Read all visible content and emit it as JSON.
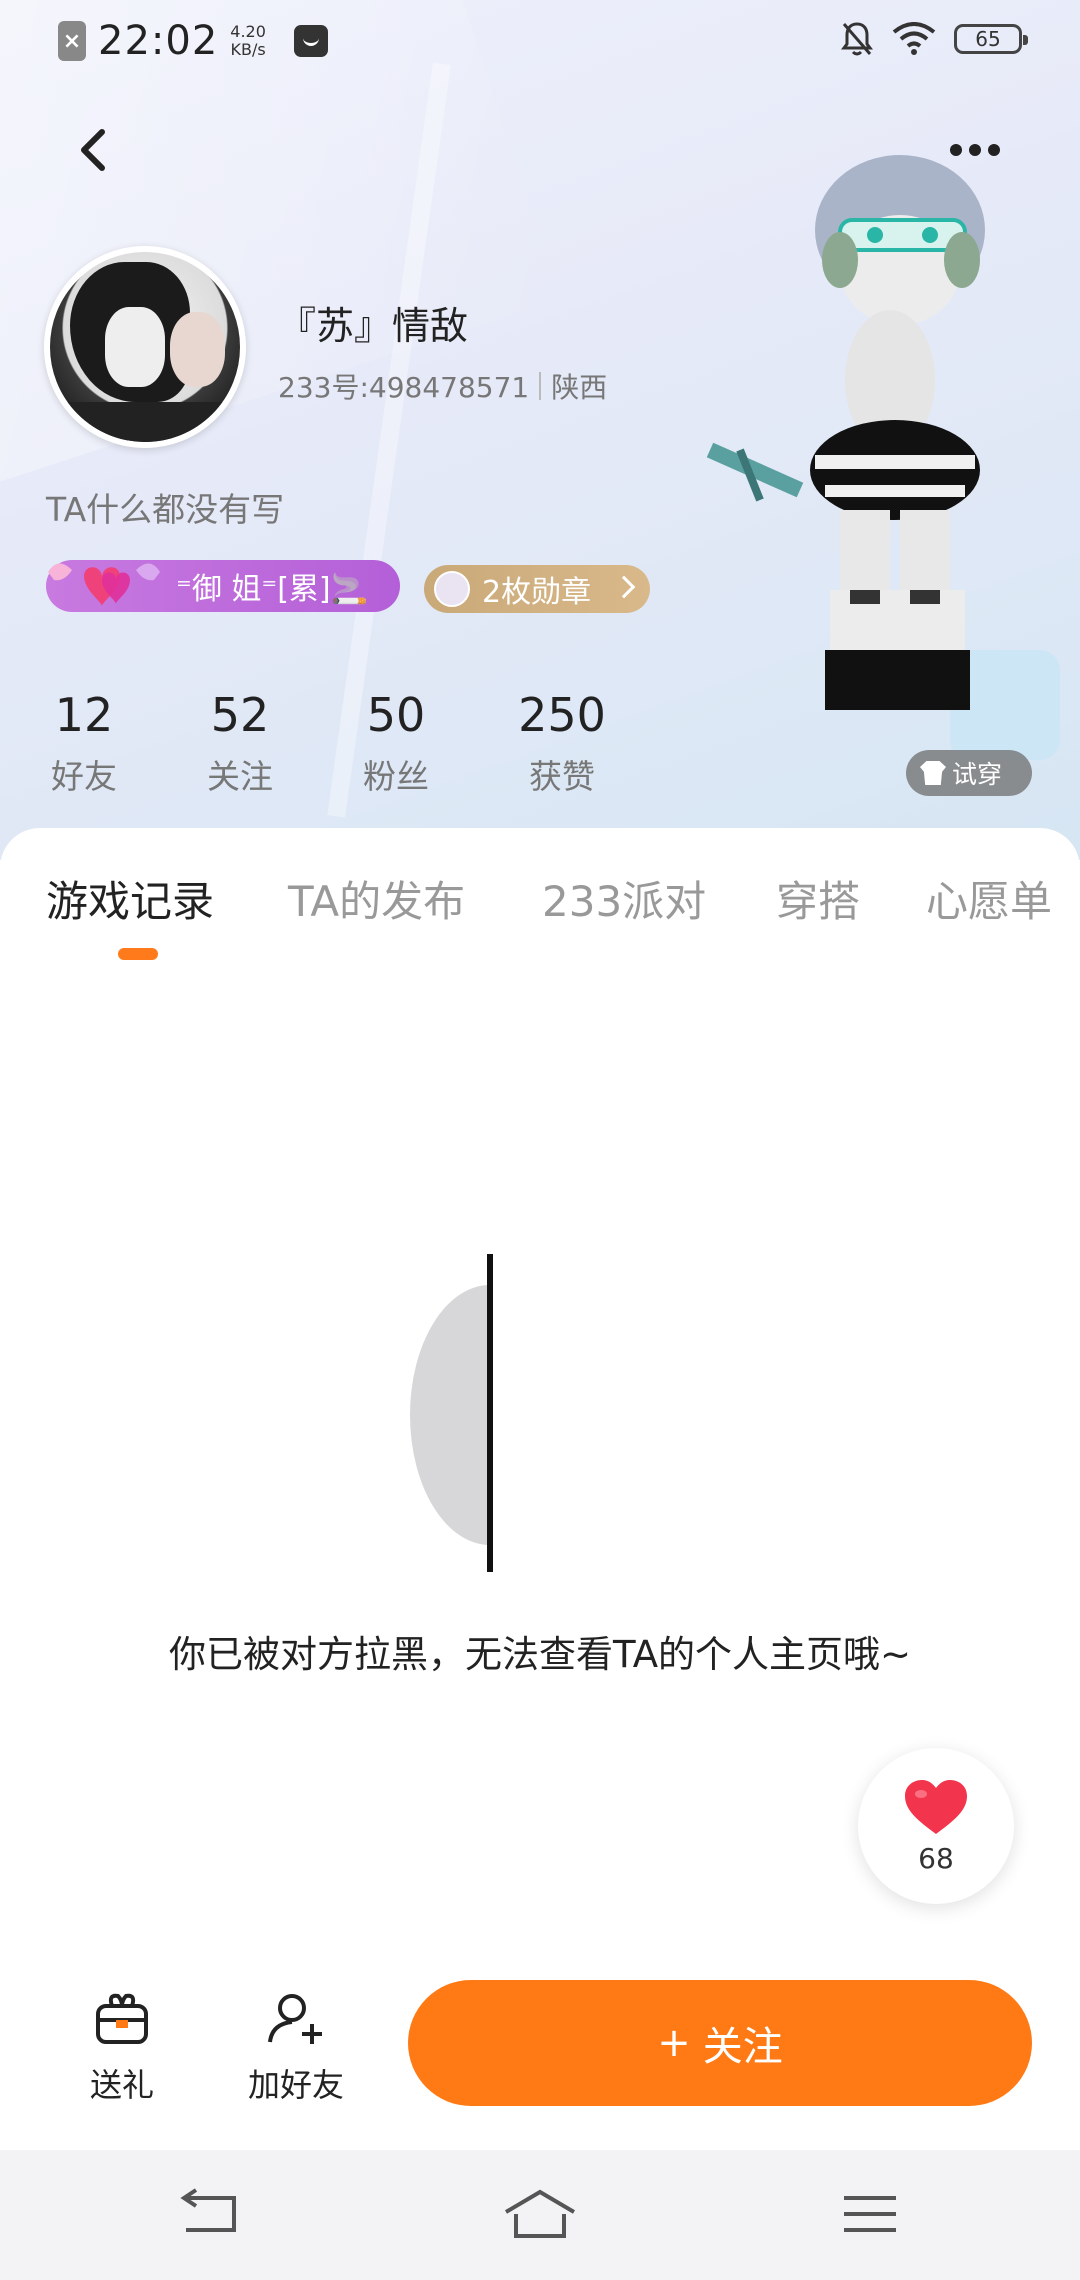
{
  "status_bar": {
    "time": "22:02",
    "speed_value": "4.20",
    "speed_unit": "KB/s",
    "battery": "65"
  },
  "profile": {
    "username": "『苏』情敌",
    "user_id": "233号:498478571",
    "region": "陕西",
    "bio": "TA什么都没有写",
    "title_badge": "⁼御 姐⁼[累]🚬",
    "medal_badge": "2枚勋章",
    "try_on": "试穿"
  },
  "stats": [
    {
      "value": "12",
      "label": "好友"
    },
    {
      "value": "52",
      "label": "关注"
    },
    {
      "value": "50",
      "label": "粉丝"
    },
    {
      "value": "250",
      "label": "获赞"
    }
  ],
  "tabs": [
    {
      "label": "游戏记录",
      "active": true
    },
    {
      "label": "TA的发布",
      "active": false
    },
    {
      "label": "233派对",
      "active": false
    },
    {
      "label": "穿搭",
      "active": false
    },
    {
      "label": "心愿单",
      "active": false
    }
  ],
  "empty_state": {
    "message": "你已被对方拉黑，无法查看TA的个人主页哦~"
  },
  "like_float": {
    "count": "68"
  },
  "action_bar": {
    "gift_label": "送礼",
    "add_friend_label": "加好友",
    "follow_label": "关注",
    "follow_icon": "+"
  },
  "colors": {
    "accent": "#ff7a14",
    "title_badge": "#b45fd8",
    "medal_badge": "#d0b080"
  }
}
